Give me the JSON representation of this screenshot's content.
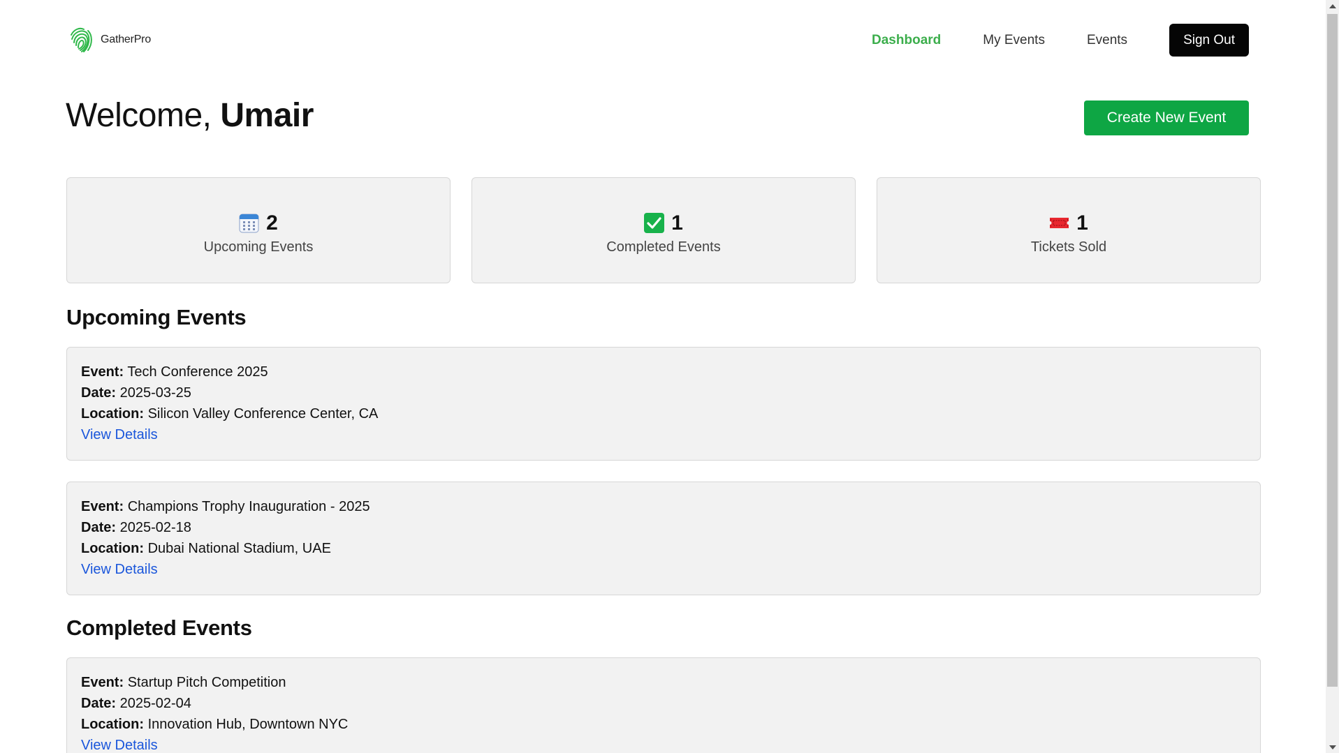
{
  "nav": {
    "brand": "GatherPro",
    "links": [
      {
        "label": "Dashboard",
        "active": true
      },
      {
        "label": "My Events",
        "active": false
      },
      {
        "label": "Events",
        "active": false
      }
    ],
    "signout_label": "Sign Out"
  },
  "header": {
    "greeting": "Welcome,",
    "user_name": "Umair",
    "create_label": "Create New Event"
  },
  "stats": [
    {
      "icon": "calendar-icon",
      "count": "2",
      "label": "Upcoming Events"
    },
    {
      "icon": "check-icon",
      "count": "1",
      "label": "Completed Events"
    },
    {
      "icon": "ticket-icon",
      "count": "1",
      "label": "Tickets Sold"
    }
  ],
  "sections": {
    "upcoming_title": "Upcoming Events",
    "completed_title": "Completed Events"
  },
  "field_labels": {
    "event": "Event:",
    "date": "Date:",
    "location": "Location:",
    "link": "View Details"
  },
  "upcoming_events": [
    {
      "name": "Tech Conference 2025",
      "date": "2025-03-25",
      "location": "Silicon Valley Conference Center, CA"
    },
    {
      "name": "Champions Trophy Inauguration - 2025",
      "date": "2025-02-18",
      "location": "Dubai National Stadium, UAE"
    }
  ],
  "completed_events": [
    {
      "name": "Startup Pitch Competition",
      "date": "2025-02-04",
      "location": "Innovation Hub, Downtown NYC"
    }
  ],
  "colors": {
    "brand_green": "#3cae4c",
    "button_green": "#0ea644",
    "link_blue": "#1a56db",
    "card_bg": "#f2f2f2"
  }
}
